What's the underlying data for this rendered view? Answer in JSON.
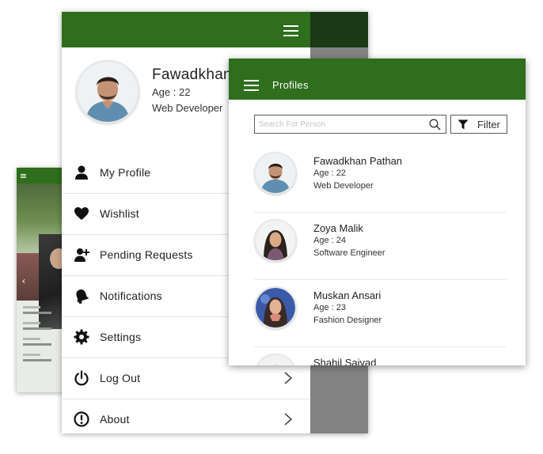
{
  "drawer": {
    "profile": {
      "name": "Fawadkhan",
      "age": "Age : 22",
      "job": "Web Developer"
    },
    "menu": [
      {
        "label": "My Profile",
        "icon": "user-icon"
      },
      {
        "label": "Wishlist",
        "icon": "heart-icon"
      },
      {
        "label": "Pending Requests",
        "icon": "add-user-icon"
      },
      {
        "label": "Notifications",
        "icon": "bell-icon"
      },
      {
        "label": "Settings",
        "icon": "gear-icon"
      },
      {
        "label": "Log Out",
        "icon": "power-icon"
      },
      {
        "label": "About",
        "icon": "info-icon"
      }
    ]
  },
  "profiles": {
    "title": "Profiles",
    "search": {
      "placeholder": "Search For Person",
      "value": ""
    },
    "filter_label": "Filter",
    "people": [
      {
        "name": "Fawadkhan Pathan",
        "age": "Age : 22",
        "job": "Web Developer"
      },
      {
        "name": "Zoya Malik",
        "age": "Age : 24",
        "job": "Software Engineer"
      },
      {
        "name": "Muskan Ansari",
        "age": "Age : 23",
        "job": "Fashion Designer"
      },
      {
        "name": "Shahil Saiyad",
        "age": "",
        "job": ""
      }
    ]
  },
  "colors": {
    "primary": "#2e6e1c",
    "dark_primary": "#1b3915",
    "overlay": "#828282"
  }
}
